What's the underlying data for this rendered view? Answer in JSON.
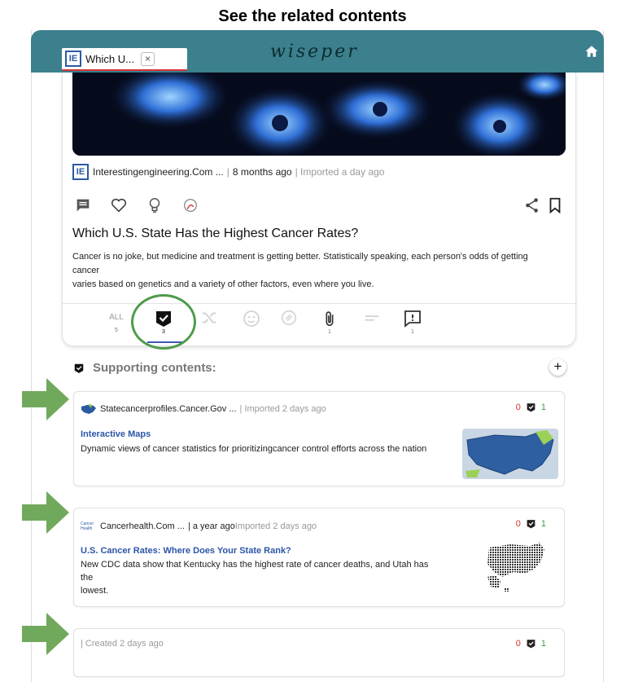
{
  "caption": "See the related contents",
  "header": {
    "tab_title": "Which U...",
    "tab_close": "×",
    "tab_favicon": "IE",
    "logo": "wiseper",
    "colors": {
      "bar": "#3b808c",
      "tab_underline": "#d9353b"
    }
  },
  "main_card": {
    "source_favicon": "IE",
    "source_name": "Interestingengineering.Com ...",
    "source_sep": "|",
    "source_age": "8 months ago",
    "source_imported": "| Imported a day ago",
    "title": "Which U.S. State Has the Highest Cancer Rates?",
    "desc_line1": "Cancer is no joke, but medicine and treatment is getting better. Statistically speaking, each person's odds of getting",
    "desc_line2": "cancer",
    "desc_line3": "varies based on genetics and a variety of other factors, even where you live.",
    "actions": [
      "comment-icon",
      "heart-icon",
      "lightbulb-icon",
      "person-annotate-icon",
      "share-icon",
      "bookmark-icon"
    ],
    "filter_tabs": [
      {
        "label": "ALL",
        "count": "5"
      },
      {
        "label": "supporting",
        "count": "3"
      },
      {
        "label": "conflicting",
        "count": ""
      },
      {
        "label": "related-people",
        "count": ""
      },
      {
        "label": "linked",
        "count": ""
      },
      {
        "label": "attachments",
        "count": "1"
      },
      {
        "label": "notes",
        "count": ""
      },
      {
        "label": "comments",
        "count": "1"
      }
    ]
  },
  "supporting": {
    "heading": "Supporting contents:",
    "add_label": "+"
  },
  "related": [
    {
      "source": "Statecancerprofiles.Cancer.Gov ...",
      "meta": "| Imported 2 days ago",
      "down": "0",
      "up": "1",
      "title": "Interactive Maps",
      "desc": "Dynamic views of cancer statistics for prioritizingcancer control efforts across the nation"
    },
    {
      "source": "Cancerhealth.Com ...",
      "meta_age": "| a year ago",
      "meta": "Imported 2 days ago",
      "favicon_text": "Cancer Health",
      "down": "0",
      "up": "1",
      "title": "U.S. Cancer Rates: Where Does Your State Rank?",
      "desc_line1": "New CDC data show that Kentucky has the highest rate of cancer deaths, and Utah has",
      "desc_line2": "the",
      "desc_line3": "lowest."
    },
    {
      "meta": "| Created 2 days ago",
      "down": "0",
      "up": "1"
    }
  ],
  "colors": {
    "accent_green": "#4f9b4b",
    "link_blue": "#2c55a8",
    "vote_red": "#d2302c",
    "vote_green": "#3d9a3d"
  }
}
